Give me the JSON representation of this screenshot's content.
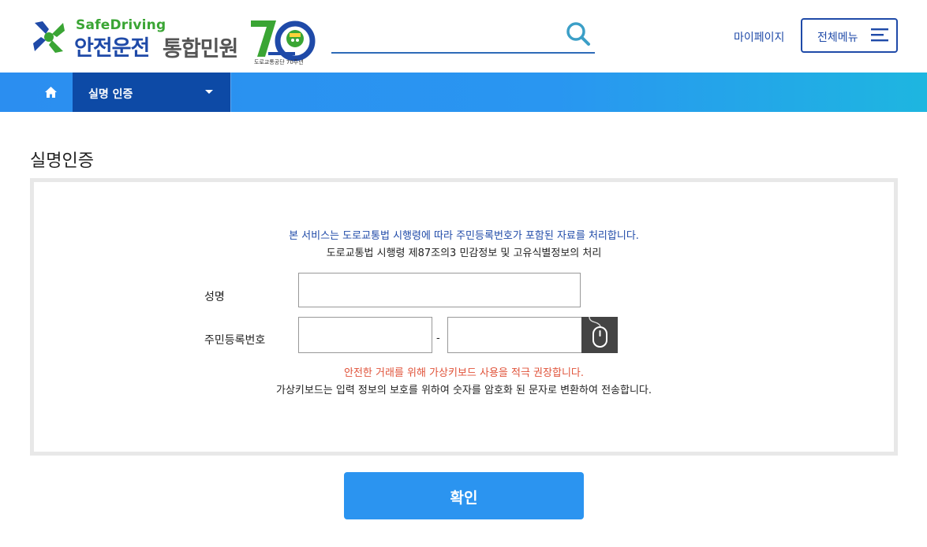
{
  "header": {
    "logo_en": "SafeDriving",
    "logo_ko_main": "안전운전",
    "logo_ko_sub": "통합민원",
    "logo_70_caption": "도로교통공단 70주년",
    "mypage_label": "마이페이지",
    "menu_label": "전체메뉴"
  },
  "search": {
    "value": "",
    "placeholder": ""
  },
  "nav": {
    "current_label": "실명 인증"
  },
  "page": {
    "title": "실명인증"
  },
  "form": {
    "notice_primary": "본 서비스는 도로교통법 시행령에 따라 주민등록번호가 포함된 자료를 처리합니다.",
    "notice_secondary": "도로교통법 시행령 제87조의3 민감정보 및 고유식별정보의 처리",
    "name_label": "성명",
    "name_value": "",
    "rrn_label": "주민등록번호",
    "rrn_front_value": "",
    "rrn_separator": "-",
    "rrn_back_value": "",
    "warning_primary": "안전한 거래를 위해 가상키보드 사용을 적극 권장합니다.",
    "warning_secondary": "가상키보드는 입력 정보의 보호를 위하여 숫자를 암호화 된 문자로 변환하여 전송합니다.",
    "confirm_label": "확인"
  },
  "icons": {
    "search": "search-icon",
    "menu": "hamburger-icon",
    "home": "home-icon",
    "dropdown": "chevron-down-icon",
    "virtual_keyboard": "mouse-icon"
  },
  "colors": {
    "brand_blue": "#1f4aa8",
    "nav_blue": "#2b8ef0",
    "nav_active": "#0d4aa6",
    "logo_green": "#3aa534",
    "warning_red": "#e0533a",
    "button_blue": "#2b94f0"
  }
}
